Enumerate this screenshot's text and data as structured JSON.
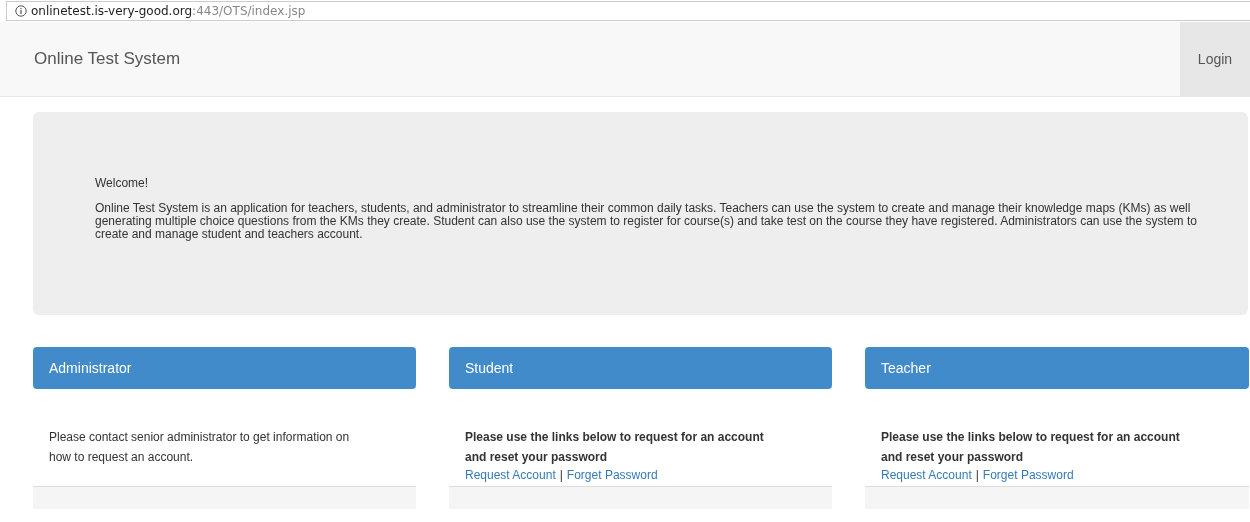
{
  "address_bar": {
    "host": "onlinetest.is-very-good.org",
    "path": ":443/OTS/index.jsp"
  },
  "navbar": {
    "brand": "Online Test System",
    "login": "Login"
  },
  "jumbotron": {
    "greeting": "Welcome!",
    "text": "Online Test System is an application for teachers, students, and administrator to streamline their common daily tasks. Teachers can use the system to create and manage their knowledge maps (KMs) as well generating multiple choice questions from the KMs they create. Student can also use the system to register for course(s) and take test on the course they have registered. Administrators can use the system to create and manage student and teachers account."
  },
  "panels": [
    {
      "title": "Administrator",
      "kind": "info",
      "text": "Please contact senior administrator to get information on how to request an account."
    },
    {
      "title": "Student",
      "kind": "links",
      "text": "Please use the links below to request for an account and reset your password",
      "links": [
        "Request Account",
        "Forget Password"
      ],
      "separator": "|"
    },
    {
      "title": "Teacher",
      "kind": "links",
      "text": "Please use the links below to request for an account and reset your password",
      "links": [
        "Request Account",
        "Forget Password"
      ],
      "separator": "|"
    }
  ]
}
